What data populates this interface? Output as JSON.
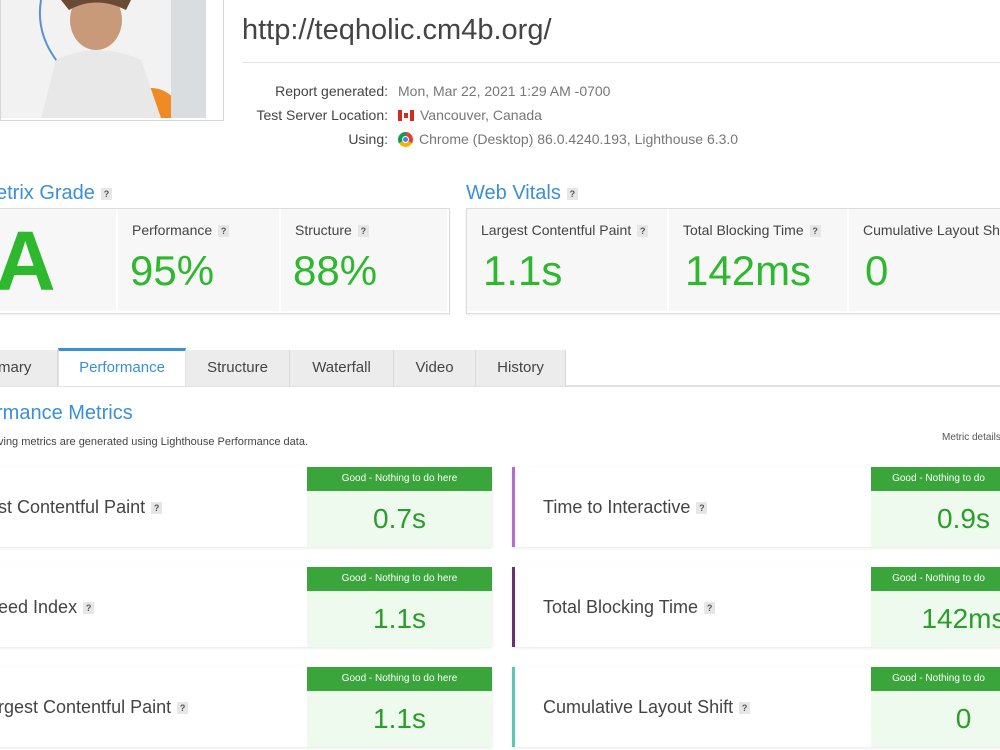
{
  "header": {
    "url": "http://teqholic.cm4b.org/",
    "meta": [
      {
        "label": "Report generated:",
        "value": "Mon, Mar 22, 2021 1:29 AM -0700",
        "icon": ""
      },
      {
        "label": "Test Server Location:",
        "value": "Vancouver, Canada",
        "icon": "canada-flag-icon"
      },
      {
        "label": "Using:",
        "value": "Chrome (Desktop) 86.0.4240.193, Lighthouse 6.3.0",
        "icon": "chrome-icon"
      }
    ]
  },
  "grade_section": {
    "title": "etrix Grade",
    "grade": "A",
    "performance": {
      "label": "Performance",
      "value": "95%"
    },
    "structure": {
      "label": "Structure",
      "value": "88%"
    }
  },
  "web_vitals": {
    "title": "Web Vitals",
    "lcp": {
      "label": "Largest Contentful Paint",
      "value": "1.1s"
    },
    "tbt": {
      "label": "Total Blocking Time",
      "value": "142ms"
    },
    "cls": {
      "label": "Cumulative Layout Sh",
      "value": "0"
    }
  },
  "tabs": [
    {
      "label": "mary"
    },
    {
      "label": "Performance"
    },
    {
      "label": "Structure"
    },
    {
      "label": "Waterfall"
    },
    {
      "label": "Video"
    },
    {
      "label": "History"
    }
  ],
  "perf_metrics": {
    "title": "rmance Metrics",
    "subtitle": "ving metrics are generated using Lighthouse Performance data.",
    "details_link": "Metric details",
    "left": [
      {
        "name": "st Contentful Paint",
        "status": "Good - Nothing to do here",
        "value": "0.7s"
      },
      {
        "name": "eed Index",
        "status": "Good - Nothing to do here",
        "value": "1.1s"
      },
      {
        "name": "rgest Contentful Paint",
        "status": "Good - Nothing to do here",
        "value": "1.1s"
      }
    ],
    "right": [
      {
        "name": "Time to Interactive",
        "status": "Good - Nothing to do",
        "value": "0.9s",
        "accent": "#b06fd0"
      },
      {
        "name": "Total Blocking Time",
        "status": "Good - Nothing to do",
        "value": "142ms",
        "accent": "#6b2f73"
      },
      {
        "name": "Cumulative Layout Shift",
        "status": "Good - Nothing to do",
        "value": "0",
        "accent": "#5cc6b0"
      }
    ]
  },
  "colors": {
    "accent": "#3a8fd8",
    "good": "#2eb82e",
    "status_bg": "#3aa53a"
  }
}
